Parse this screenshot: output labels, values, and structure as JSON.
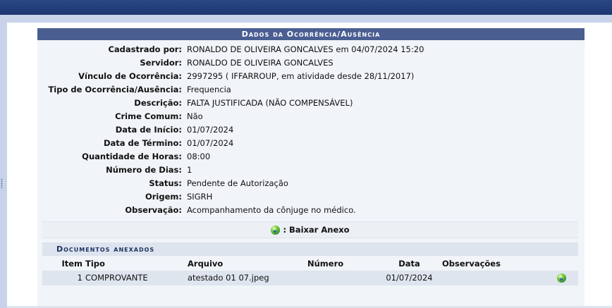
{
  "panel": {
    "title": "Dados da Ocorrência/Ausência",
    "fields": [
      {
        "label": "Cadastrado por:",
        "value": "RONALDO DE OLIVEIRA GONCALVES em 04/07/2024 15:20"
      },
      {
        "label": "Servidor:",
        "value": "RONALDO DE OLIVEIRA GONCALVES"
      },
      {
        "label": "Vínculo de Ocorrência:",
        "value": "2997295 ( IFFARROUP, em atividade desde 28/11/2017)"
      },
      {
        "label": "Tipo de Ocorrência/Ausência:",
        "value": "Frequencia"
      },
      {
        "label": "Descrição:",
        "value": "FALTA JUSTIFICADA (NÃO COMPENSÁVEL)"
      },
      {
        "label": "Crime Comum:",
        "value": "Não"
      },
      {
        "label": "Data de Início:",
        "value": "01/07/2024"
      },
      {
        "label": "Data de Término:",
        "value": "01/07/2024"
      },
      {
        "label": "Quantidade de Horas:",
        "value": "08:00"
      },
      {
        "label": "Número de Dias:",
        "value": "1"
      },
      {
        "label": "Status:",
        "value": "Pendente de Autorização"
      },
      {
        "label": "Origem:",
        "value": "SIGRH"
      },
      {
        "label": "Observação:",
        "value": "Acompanhamento da cônjuge no médico."
      }
    ],
    "download_label": ": Baixar Anexo",
    "download_icon": "download-icon"
  },
  "documents": {
    "caption": "Documentos anexados",
    "columns": [
      "Item",
      "Tipo",
      "Arquivo",
      "Número",
      "Data",
      "Observações"
    ],
    "rows": [
      {
        "item": "1",
        "tipo": "COMPROVANTE",
        "arquivo": "atestado 01 07.jpeg",
        "numero": "",
        "data": "01/07/2024",
        "observacoes": ""
      }
    ]
  },
  "colors": {
    "header_band": "#1d3670",
    "panel_header": "#4a5e92",
    "caption_text": "#1f3263"
  }
}
